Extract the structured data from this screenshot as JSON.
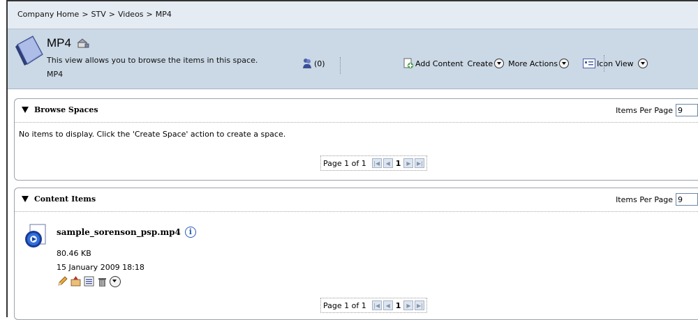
{
  "breadcrumb": {
    "items": [
      "Company Home",
      "STV",
      "Videos",
      "MP4"
    ],
    "separator": ">"
  },
  "space": {
    "title": "MP4",
    "description": "This view allows you to browse the items in this space.",
    "subtitle": "MP4",
    "users_count": "(0)"
  },
  "actions": {
    "add_content": "Add Content",
    "create": "Create",
    "more_actions": "More Actions",
    "icon_view": "Icon View"
  },
  "browse_spaces": {
    "title": "Browse Spaces",
    "items_per_page_label": "Items Per Page",
    "items_per_page_value": "9",
    "empty_message": "No items to display. Click the 'Create Space' action to create a space.",
    "pager_text": "Page 1 of 1",
    "current_page": "1"
  },
  "content_items": {
    "title": "Content Items",
    "items_per_page_label": "Items Per Page",
    "items_per_page_value": "9",
    "pager_text": "Page 1 of 1",
    "current_page": "1",
    "items": [
      {
        "name": "sample_sorenson_psp.mp4",
        "size": "80.46 KB",
        "date": "15 January 2009 18:18"
      }
    ]
  },
  "colors": {
    "header_bg": "#cbd8e5",
    "breadcrumb_bg": "#e4ebf3",
    "link_blue": "#2a5bb8"
  }
}
